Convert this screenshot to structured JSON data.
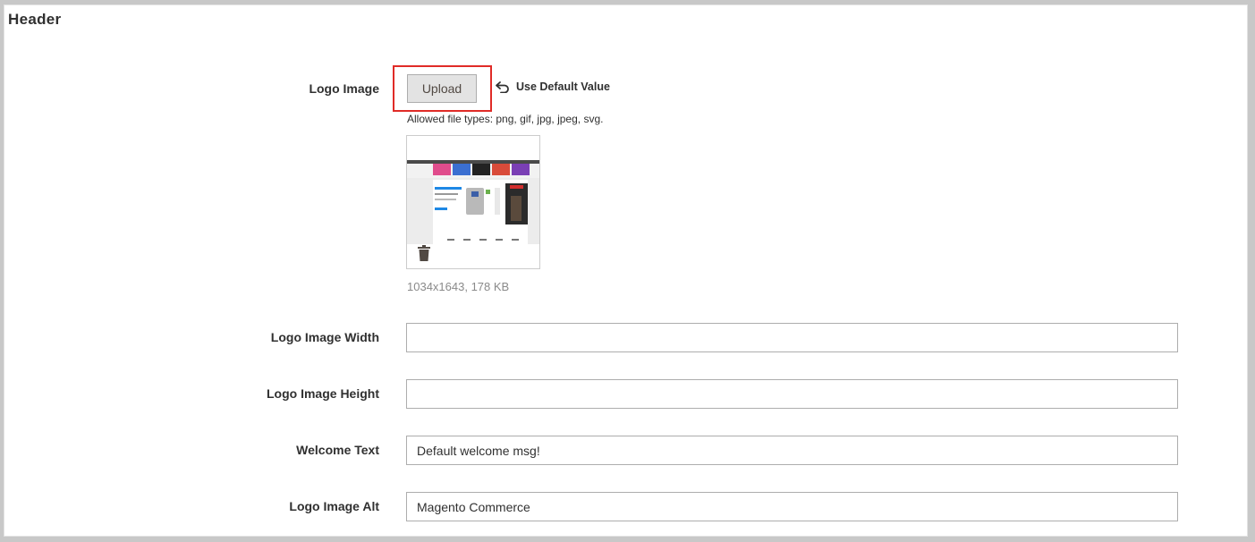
{
  "section": {
    "title": "Header"
  },
  "logo_image": {
    "label": "Logo Image",
    "upload_label": "Upload",
    "use_default_label": "Use Default Value",
    "allowed_types": "Allowed file types: png, gif, jpg, jpeg, svg.",
    "file_meta": "1034x1643, 178 KB"
  },
  "fields": {
    "width": {
      "label": "Logo Image Width",
      "value": ""
    },
    "height": {
      "label": "Logo Image Height",
      "value": ""
    },
    "welcome": {
      "label": "Welcome Text",
      "value": "Default welcome msg!"
    },
    "alt": {
      "label": "Logo Image Alt",
      "value": "Magento Commerce"
    }
  },
  "colors": {
    "highlight": "#e02b27",
    "button_bg": "#e3e3e3",
    "label_text": "#303030",
    "meta_text": "#8a8a8a"
  },
  "icons": {
    "use_default": "undo-arrow-icon",
    "delete": "trash-icon"
  }
}
